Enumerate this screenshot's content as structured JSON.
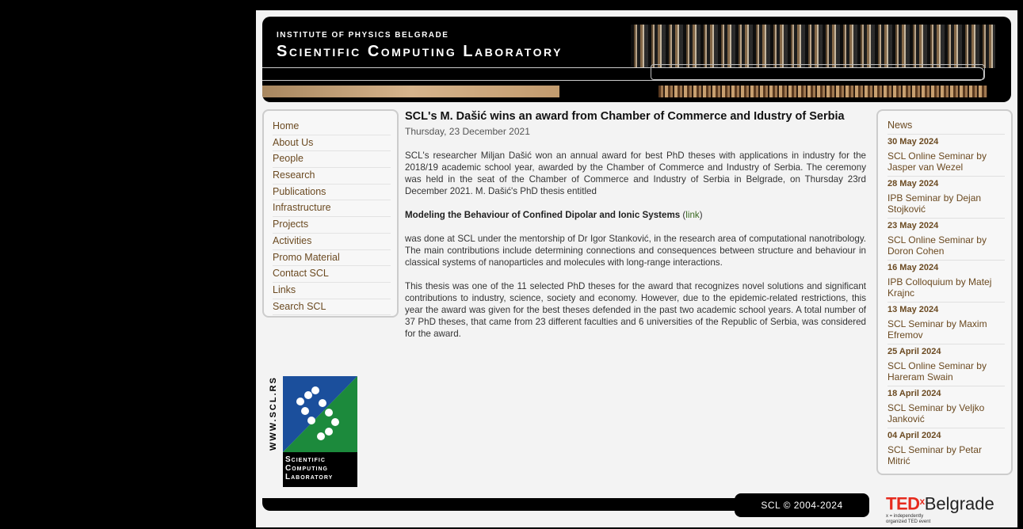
{
  "banner": {
    "institute": "INSTITUTE OF PHYSICS BELGRADE",
    "lab": "Scientific Computing Laboratory"
  },
  "nav": [
    "Home",
    "About Us",
    "People",
    "Research",
    "Publications",
    "Infrastructure",
    "Projects",
    "Activities",
    "Promo Material",
    "Contact SCL",
    "Links",
    "Search SCL"
  ],
  "article": {
    "title": "SCL's M. Dašić wins an award from Chamber of Commerce and Idustry of Serbia",
    "date": "Thursday, 23 December 2021",
    "p1": "SCL's researcher Miljan Dašić won an annual award for best PhD theses with applications in industry for the 2018/19 academic school year, awarded by the Chamber of Commerce and Industry of Serbia.  The ceremony was held in the seat of the Chamber of Commerce and Industry of Serbia in Belgrade, on Thursday 23rd December 2021. M. Dašić's PhD thesis entitled",
    "thesis_title": "Modeling the Behaviour of Confined Dipolar and Ionic Systems",
    "link_open": " (",
    "link_label": "link",
    "link_close": ")",
    "p2": "was done at SCL under the mentorship of Dr Igor Stanković, in the research area of computational nanotribology. The main contributions include determining connections and consequences between structure and behaviour in classical systems of nanoparticles and molecules with long-range interactions.",
    "p3": "This thesis was one of the 11 selected PhD theses for the award that recognizes novel solutions and significant contributions to industry, science, society and economy. However, due to the epidemic-related restrictions, this year the award was given for the best theses defended in the past two academic school years.  A total number of 37 PhD theses, that came from 23 different faculties and 6 universities of the Republic of Serbia, was considered for the award."
  },
  "news": {
    "header": "News",
    "items": [
      {
        "date": "30 May 2024",
        "title": "SCL Online Seminar by Jasper van Wezel"
      },
      {
        "date": "28 May 2024",
        "title": "IPB Seminar by Dejan Stojković"
      },
      {
        "date": "23 May 2024",
        "title": "SCL Online Seminar by Doron Cohen"
      },
      {
        "date": "16 May 2024",
        "title": "IPB Colloquium by Matej Krajnc"
      },
      {
        "date": "13 May 2024",
        "title": "SCL Seminar by Maxim Efremov"
      },
      {
        "date": "25 April 2024",
        "title": "SCL Online Seminar by Hareram Swain"
      },
      {
        "date": "18 April 2024",
        "title": "SCL Seminar by Veljko Janković"
      },
      {
        "date": "04 April 2024",
        "title": "SCL Seminar by Petar Mitrić"
      }
    ]
  },
  "logo": {
    "vertical": "WWW.SCL.RS",
    "caption": [
      "Scientific",
      "Computing",
      "Laboratory"
    ]
  },
  "footer": {
    "copyright": "SCL © 2004-2024"
  },
  "ted": {
    "brand": "TED",
    "x": "x",
    "city": "Belgrade",
    "line1": "x = independently",
    "line2": "organized TED event"
  }
}
